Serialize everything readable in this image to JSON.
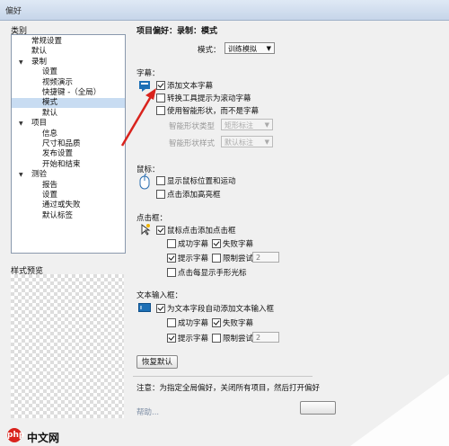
{
  "window": {
    "title": "偏好"
  },
  "left": {
    "category_label": "类别",
    "preview_label": "样式预览",
    "tree": [
      {
        "label": "常规设置",
        "level": 1,
        "arrow": false,
        "selected": false
      },
      {
        "label": "默认",
        "level": 1,
        "arrow": false,
        "selected": false
      },
      {
        "label": "录制",
        "level": 1,
        "arrow": true,
        "selected": false
      },
      {
        "label": "设置",
        "level": 2,
        "arrow": false,
        "selected": false
      },
      {
        "label": "视频演示",
        "level": 2,
        "arrow": false,
        "selected": false
      },
      {
        "label": "快捷键 -（全局）",
        "level": 2,
        "arrow": false,
        "selected": false
      },
      {
        "label": "模式",
        "level": 2,
        "arrow": false,
        "selected": true
      },
      {
        "label": "默认",
        "level": 2,
        "arrow": false,
        "selected": false
      },
      {
        "label": "项目",
        "level": 1,
        "arrow": true,
        "selected": false
      },
      {
        "label": "信息",
        "level": 2,
        "arrow": false,
        "selected": false
      },
      {
        "label": "尺寸和品质",
        "level": 2,
        "arrow": false,
        "selected": false
      },
      {
        "label": "发布设置",
        "level": 2,
        "arrow": false,
        "selected": false
      },
      {
        "label": "开始和结束",
        "level": 2,
        "arrow": false,
        "selected": false
      },
      {
        "label": "测验",
        "level": 1,
        "arrow": true,
        "selected": false
      },
      {
        "label": "报告",
        "level": 2,
        "arrow": false,
        "selected": false
      },
      {
        "label": "设置",
        "level": 2,
        "arrow": false,
        "selected": false
      },
      {
        "label": "通过或失败",
        "level": 2,
        "arrow": false,
        "selected": false
      },
      {
        "label": "默认标签",
        "level": 2,
        "arrow": false,
        "selected": false
      }
    ]
  },
  "right": {
    "header": "项目偏好：录制：模式",
    "mode_label": "模式：",
    "mode_value": "训练模拟",
    "captions": {
      "title": "字幕：",
      "add_text": "添加文本字幕",
      "convert": "转换工具提示为滚动字幕",
      "smart_shape": "使用智能形状，而不是字幕",
      "sel1_label": "智能形状类型",
      "sel1_value": "矩形标注",
      "sel2_label": "智能形状样式",
      "sel2_value": "默认标注"
    },
    "mouse": {
      "title": "鼠标：",
      "show_pos": "显示鼠标位置和运动",
      "click_highlight": "点击添加高亮框"
    },
    "click_box": {
      "title": "点击框：",
      "mouse_click": "鼠标点击添加点击框",
      "success": "成功字幕",
      "fail": "失败字幕",
      "hint": "提示字幕",
      "limit": "限制尝试",
      "limit_value": "2",
      "hand_cursor": "点击每显示手形光标"
    },
    "text_input": {
      "title": "文本输入框：",
      "auto_add": "为文本字段自动添加文本输入框",
      "success": "成功字幕",
      "fail": "失败字幕",
      "hint": "提示字幕",
      "limit": "限制尝试",
      "limit_value": "2"
    },
    "restore_button": "恢复默认",
    "note": "注意：为指定全局偏好，关闭所有项目，然后打开偏好",
    "help": "帮助..."
  },
  "watermark": {
    "logo": "php",
    "text": "中文网"
  },
  "colors": {
    "accent": "#c8dcf2",
    "arrow": "#d9231d"
  }
}
